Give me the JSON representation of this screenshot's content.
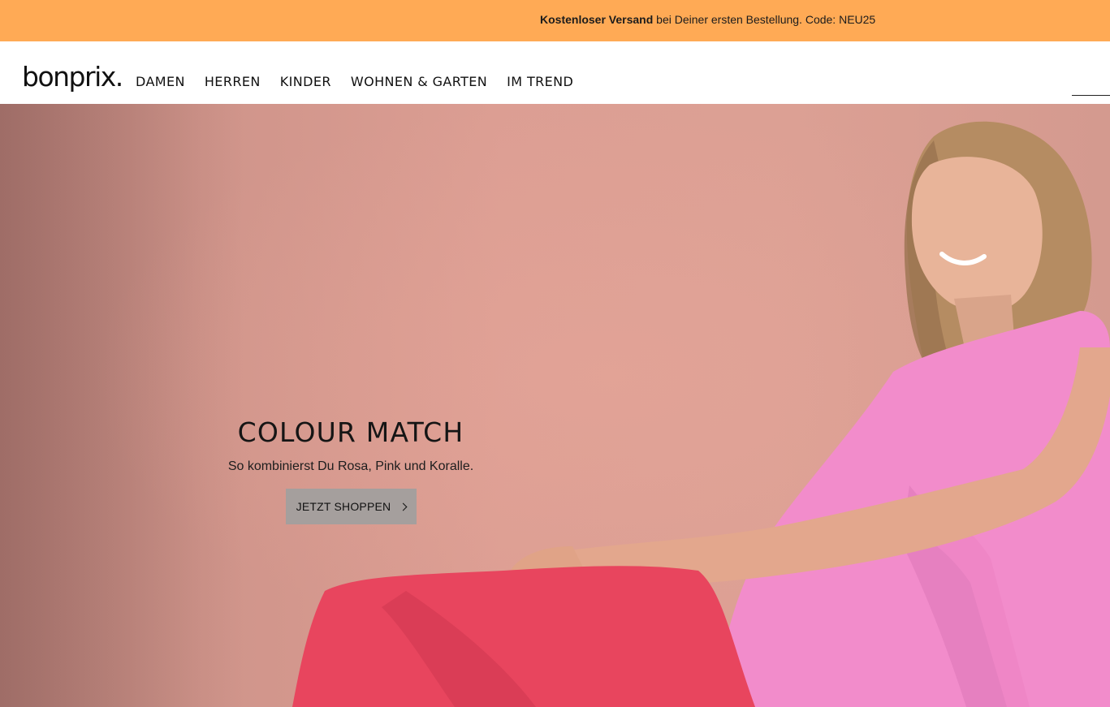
{
  "promo": {
    "bold_text": "Kostenloser Versand",
    "text": " bei Deiner ersten Bestellung. Code: NEU25"
  },
  "header": {
    "logo": "bonprix.",
    "nav": [
      {
        "label": "DAMEN"
      },
      {
        "label": "HERREN"
      },
      {
        "label": "KINDER"
      },
      {
        "label": "WOHNEN & GARTEN"
      },
      {
        "label": "IM TREND"
      }
    ]
  },
  "hero": {
    "title": "COLOUR MATCH",
    "subtitle": "So kombinierst Du Rosa, Pink und Koralle.",
    "cta_label": "JETZT SHOPPEN",
    "cta_icon": "chevron-right-icon"
  },
  "colors": {
    "promo_bg": "#FFAA55",
    "hero_bg": "#DC9E93",
    "top_color": "#F28CCB",
    "pants_color": "#E8455E",
    "cta_bg": "#A59F9D"
  }
}
